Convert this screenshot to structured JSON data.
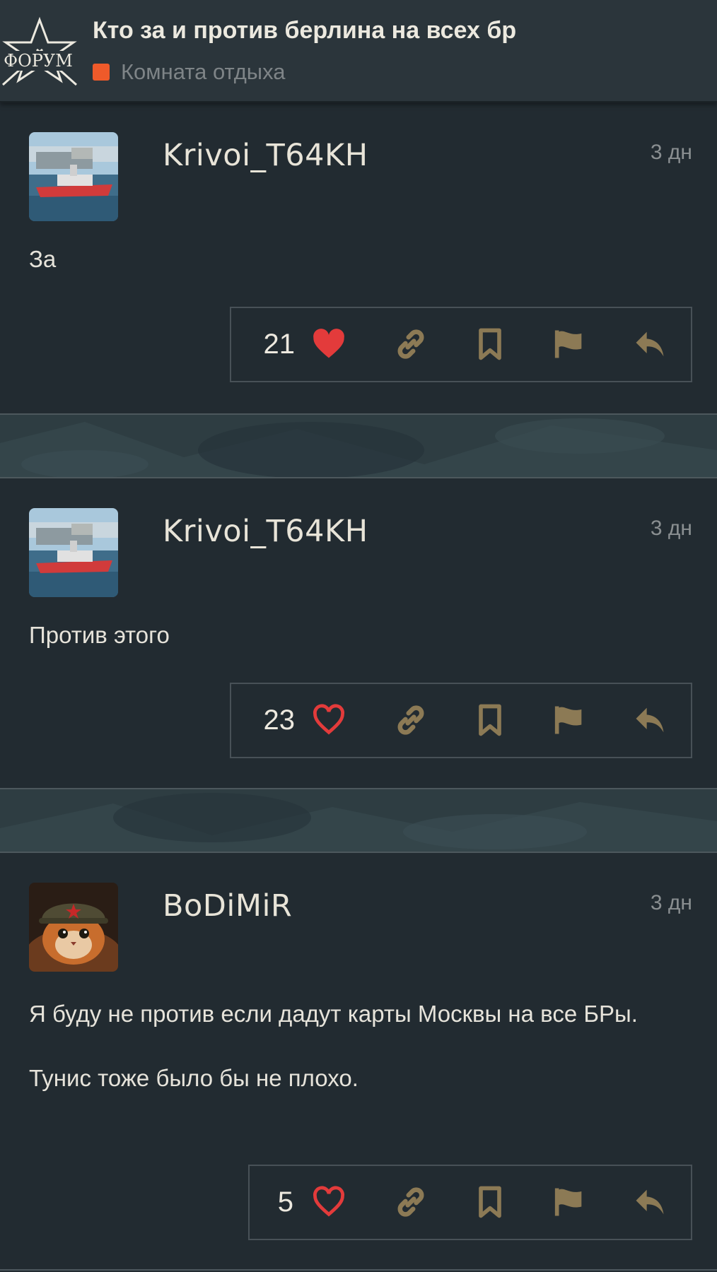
{
  "header": {
    "logo_text": "ФОРУМ",
    "title": "Кто за и против берлина на всех бр",
    "category": "Комната отдыха",
    "category_color": "#ef5a2a"
  },
  "posts": [
    {
      "username": "Krivoi_T64KH",
      "time": "3 дн",
      "body": [
        "За"
      ],
      "likes": "21",
      "liked": true
    },
    {
      "username": "Krivoi_T64KH",
      "time": "3 дн",
      "body": [
        "Против этого"
      ],
      "likes": "23",
      "liked": false
    },
    {
      "username": "BoDiMiR",
      "time": "3 дн",
      "body": [
        "Я буду не против если дадут карты Москвы на все БРы.",
        "Тунис тоже было бы не плохо."
      ],
      "likes": "5",
      "liked": false
    }
  ],
  "icons": {
    "like": "heart-icon",
    "link": "link-icon",
    "bookmark": "bookmark-icon",
    "flag": "flag-icon",
    "reply": "reply-icon"
  },
  "colors": {
    "accent_gold": "#8c7a55",
    "heart_red": "#e33b3b",
    "background": "#222b31"
  }
}
